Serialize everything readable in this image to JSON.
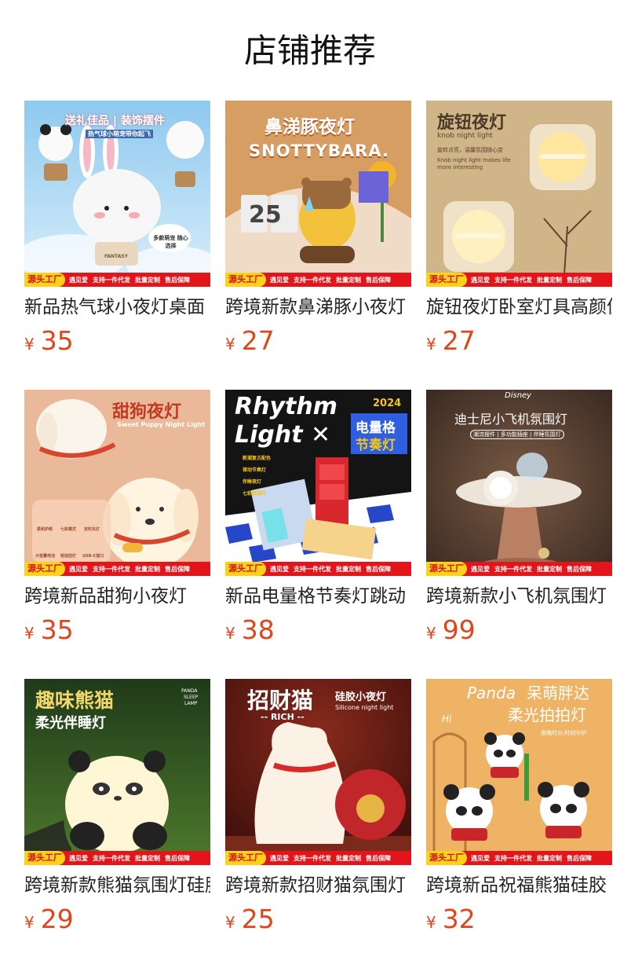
{
  "section_title": "店铺推荐",
  "banner": {
    "badge": "源头工厂",
    "tags": [
      "遇见爱",
      "支持一件代发",
      "批量定制",
      "售后保障"
    ]
  },
  "currency": "¥",
  "products": [
    {
      "name": "新品热气球小夜灯桌面",
      "price": "35",
      "art": "rabbit-balloon",
      "overlay": [
        "送礼佳品 | 装饰摆件",
        "热气球小萌宠带你起飞",
        "多款萌宠 随心选择",
        "FANTASY"
      ]
    },
    {
      "name": "跨境新款鼻涕豚小夜灯",
      "price": "27",
      "art": "capybara",
      "overlay": [
        "鼻涕豚夜灯",
        "SNOTTYBARA.",
        "25"
      ]
    },
    {
      "name": "旋钮夜灯卧室灯具高颜值",
      "price": "27",
      "art": "knob",
      "overlay": [
        "旋钮夜灯",
        "knob night light",
        "旋转点亮，温馨氛围随心变",
        "Knob night light makes life",
        "more interesting"
      ]
    },
    {
      "name": "跨境新品甜狗小夜灯",
      "price": "35",
      "art": "dog",
      "overlay": [
        "甜狗夜灯",
        "Sweet Puppy Night Light",
        "柔和护眼",
        "七彩模式",
        "定时关灯",
        "大容量电池",
        "轻拍控灯",
        "USB-C接口"
      ]
    },
    {
      "name": "新品电量格节奏灯跳动",
      "price": "38",
      "art": "rhythm",
      "overlay": [
        "Rhythm",
        "Light ✕",
        "2024",
        "电量格",
        "节奏灯",
        "新潮复古配色",
        "律动节奏灯",
        "伴睡夜灯",
        "七彩氛围灯"
      ]
    },
    {
      "name": "跨境新款小飞机氛围灯",
      "price": "99",
      "art": "plane",
      "overlay": [
        "Disney",
        "迪士尼小飞机氛围灯",
        "潮流摆件 | 多功能插座 | 伴睡氛围灯"
      ]
    },
    {
      "name": "跨境新款熊猫氛围灯硅胶",
      "price": "29",
      "art": "panda",
      "overlay": [
        "趣味熊猫",
        "柔光伴睡灯",
        "PANDA",
        "SLEEP",
        "LAMP"
      ]
    },
    {
      "name": "跨境新款招财猫氛围灯",
      "price": "25",
      "art": "cat",
      "overlay": [
        "招财猫",
        "-- RICH --",
        "硅胶小夜灯",
        "Silicone night light"
      ]
    },
    {
      "name": "跨境新品祝福熊猫硅胶",
      "price": "32",
      "art": "pandas",
      "overlay": [
        "Panda",
        "呆萌胖达",
        "柔光拍拍灯",
        "夜晚时分,时刻守护",
        "Hi"
      ]
    }
  ]
}
